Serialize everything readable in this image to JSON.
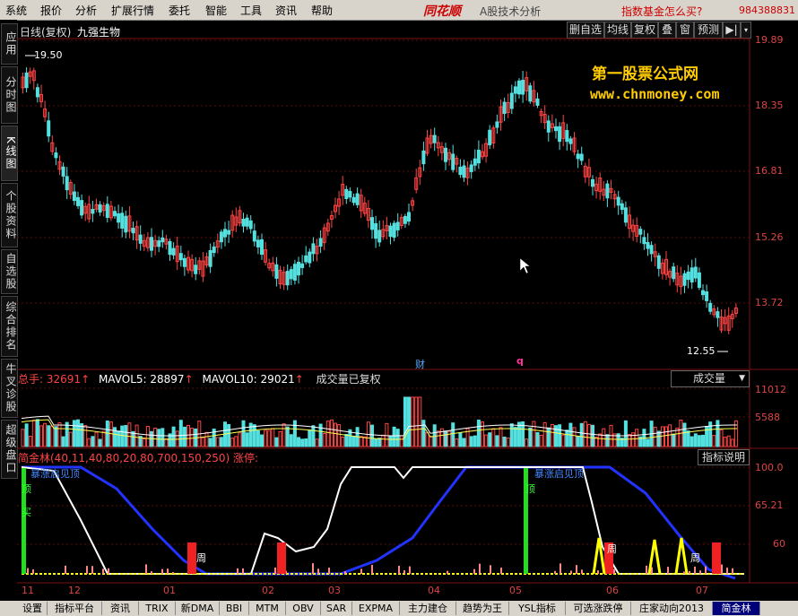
{
  "menu": [
    "系统",
    "报价",
    "分析",
    "扩展行情",
    "委托",
    "智能",
    "工具",
    "资讯",
    "帮助"
  ],
  "brand": {
    "logo": "同花顺",
    "subtitle": "A股技术分析",
    "fund_link": "指数基金怎么买?",
    "phone": "984388831"
  },
  "left_tabs": [
    {
      "label": "应用",
      "active": false
    },
    {
      "label": "分时图",
      "active": false
    },
    {
      "label": "K线图",
      "active": true
    },
    {
      "label": "个股资料",
      "active": false
    },
    {
      "label": "自选股",
      "active": false
    },
    {
      "label": "综合排名",
      "active": false
    },
    {
      "label": "牛叉诊股",
      "active": false
    },
    {
      "label": "超级盘口",
      "active": false
    }
  ],
  "chart_header": {
    "period": "日线(复权)",
    "stock": "九强生物"
  },
  "toolbar": [
    "删自选",
    "均线",
    "复权",
    "叠",
    "窗",
    "预测"
  ],
  "watermark": {
    "line1": "第一股票公式网",
    "line2": "www.chnmoney.com"
  },
  "price_axis": [
    "19.89",
    "18.35",
    "16.81",
    "15.26",
    "13.72"
  ],
  "price_marks": {
    "high": "19.50",
    "low": "12.55",
    "marker_cai": "财",
    "marker_q": "q"
  },
  "volume_header": {
    "total_label": "总手:",
    "total_value": "32691",
    "mavol5_label": "MAVOL5:",
    "mavol5_value": "28897",
    "mavol10_label": "MAVOL10:",
    "mavol10_value": "29021",
    "note": "成交量已复权",
    "dropdown": "成交量"
  },
  "volume_axis": [
    "11012",
    "5588"
  ],
  "indicator_header": {
    "title": "简金林(40,11,40,80,20,80,700,150,250)",
    "suffix": "涨停:",
    "explain_btn": "指标说明"
  },
  "indicator_axis": [
    "100.0",
    "65.21",
    "60"
  ],
  "indicator_labels": {
    "tag1": "暴涨启见顶",
    "tag2": "暴涨启见顶",
    "buy": "买",
    "top": "顶",
    "week": "周"
  },
  "months": [
    "11",
    "12",
    "01",
    "02",
    "03",
    "04",
    "05",
    "06",
    "07"
  ],
  "bottom_tabs": [
    {
      "label": "设置",
      "active": false
    },
    {
      "label": "指标平台",
      "active": false
    },
    {
      "label": "资讯",
      "active": false
    },
    {
      "label": "TRIX",
      "active": false
    },
    {
      "label": "新DMA",
      "active": false
    },
    {
      "label": "BBI",
      "active": false
    },
    {
      "label": "MTM",
      "active": false
    },
    {
      "label": "OBV",
      "active": false
    },
    {
      "label": "SAR",
      "active": false
    },
    {
      "label": "EXPMA",
      "active": false
    },
    {
      "label": "主力建仓",
      "active": false
    },
    {
      "label": "趋势为王",
      "active": false
    },
    {
      "label": "YSL指标",
      "active": false
    },
    {
      "label": "可选涨跌停",
      "active": false
    },
    {
      "label": "庄家动向2013",
      "active": false
    },
    {
      "label": "简金林",
      "active": true
    }
  ],
  "colors": {
    "up": "#ff4444",
    "down": "#55e0e0",
    "ma5": "#ffffff",
    "ma10": "#ffff55",
    "blue_line": "#2233ff",
    "axis": "#d44444",
    "bg": "#000000"
  }
}
